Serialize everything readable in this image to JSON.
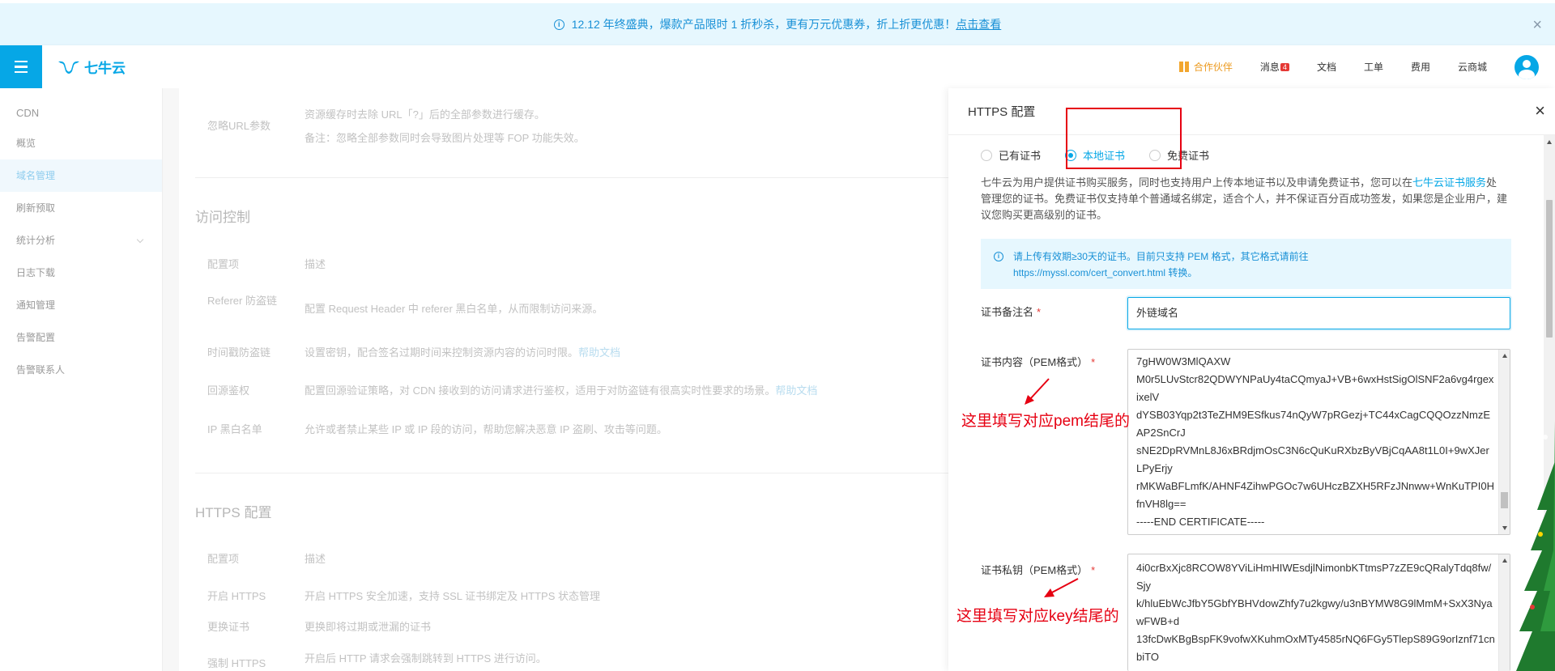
{
  "banner": {
    "text": "12.12 年终盛典，爆款产品限时 1 折秒杀，更有万元优惠券，折上折更优惠！",
    "link": "点击查看",
    "close": "×"
  },
  "header": {
    "logo_text": "七牛云",
    "nav": {
      "partner": "合作伙伴",
      "messages": "消息",
      "messages_count": "4",
      "docs": "文档",
      "tickets": "工单",
      "billing": "费用",
      "market": "云商城"
    }
  },
  "sidebar": {
    "items": [
      {
        "label": "CDN"
      },
      {
        "label": "概览"
      },
      {
        "label": "域名管理"
      },
      {
        "label": "刷新预取"
      },
      {
        "label": "统计分析"
      },
      {
        "label": "日志下载"
      },
      {
        "label": "通知管理"
      },
      {
        "label": "告警配置"
      },
      {
        "label": "告警联系人"
      }
    ]
  },
  "main": {
    "ignore_url": {
      "label": "忽略URL参数",
      "desc1": "资源缓存时去除 URL「?」后的全部参数进行缓存。",
      "desc2": "备注：忽略全部参数同时会导致图片处理等 FOP 功能失效。"
    },
    "access": {
      "title": "访问控制",
      "col1": "配置项",
      "col2": "描述",
      "rows": [
        {
          "name": "Referer 防盗链",
          "desc": "配置 Request Header 中 referer 黑白名单，从而限制访问来源。",
          "link": ""
        },
        {
          "name": "时间戳防盗链",
          "desc": "设置密钥，配合签名过期时间来控制资源内容的访问时限。",
          "link": "帮助文档"
        },
        {
          "name": "回源鉴权",
          "desc": "配置回源验证策略，对 CDN 接收到的访问请求进行鉴权，适用于对防盗链有很高实时性要求的场景。",
          "link": "帮助文档"
        },
        {
          "name": "IP 黑白名单",
          "desc": "允许或者禁止某些 IP 或 IP 段的访问，帮助您解决恶意 IP 盗刷、攻击等问题。",
          "link": ""
        }
      ]
    },
    "https": {
      "title": "HTTPS 配置",
      "col1": "配置项",
      "col2": "描述",
      "rows": [
        {
          "name": "开启 HTTPS",
          "desc": "开启 HTTPS 安全加速，支持 SSL 证书绑定及 HTTPS 状态管理"
        },
        {
          "name": "更换证书",
          "desc": "更换即将过期或泄漏的证书"
        },
        {
          "name": "强制 HTTPS",
          "desc": "开启后 HTTP 请求会强制跳转到 HTTPS 进行访问。"
        }
      ]
    }
  },
  "drawer": {
    "title": "HTTPS 配置",
    "close": "×",
    "radios": {
      "existing": "已有证书",
      "local": "本地证书",
      "free": "免费证书",
      "selected": "本地证书"
    },
    "desc_pre": "七牛云为用户提供证书购买服务，同时也支持用户上传本地证书以及申请免费证书，您可以在",
    "desc_link": "七牛云证书服务",
    "desc_post": "处管理您的证书。免费证书仅支持单个普通域名绑定，适合个人，并不保证百分百成功签发，如果您是企业用户，建议您购买更高级别的证书。",
    "tip_line1": "请上传有效期≥30天的证书。目前只支持 PEM 格式，其它格式请前往",
    "tip_line2": "https://myssl.com/cert_convert.html 转换。",
    "name_label": "证书备注名",
    "name_value": "外链域名",
    "cert_label": "证书内容（PEM格式）",
    "cert_lines": [
      "7gHW0W3MlQAXW",
      "M0r5LUvStcr82QDWYNPaUy4taCQmyaJ+VB+6wxHstSigOlSNF2a6vg4rgexixelV",
      "dYSB03Yqp2t3TeZHM9ESfkus74nQyW7pRGezj+TC44xCagCQQOzzNmzEAP2SnCrJ",
      "sNE2DpRVMnL8J6xBRdjmOsC3N6cQuKuRXbzByVBjCqAA8t1L0I+9wXJerLPyErjy",
      "rMKWaBFLmfK/AHNF4ZihwPGOc7w6UHczBZXH5RFzJNnww+WnKuTPI0HfnVH8lg==",
      "-----END CERTIFICATE-----"
    ],
    "key_label": "证书私钥（PEM格式）",
    "key_lines": [
      "4i0crBxXjc8RCOW8YViLiHmHIWEsdjlNimonbKTtmsP7zZE9cQRalyTdq8fw/Sjy",
      "k/hluEbWcJfbY5GbfYBHVdowZhfy7u2kgwy/u3nBYMW8G9lMmM+SxX3NyawFWB+d",
      "13fcDwKBgBspFK9vofwXKuhmOxMTy4585rNQ6FGy5TlepS89G9orIznf71cnbiTO"
    ],
    "annot_cert": "这里填写对应pem结尾的",
    "annot_key": "这里填写对应key结尾的"
  },
  "colors": {
    "brand": "#06a7e6",
    "annotation": "#e60012",
    "partner": "#ec9a1f"
  }
}
